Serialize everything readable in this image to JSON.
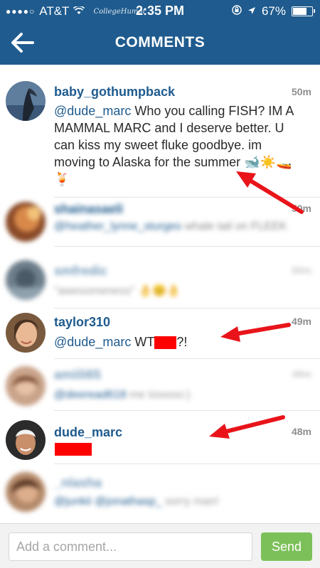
{
  "status_bar": {
    "carrier": "AT&T",
    "signal_dots": "●●●●○",
    "watermark": "CollegeHumor",
    "time": "2:35 PM",
    "battery": "67%"
  },
  "nav": {
    "title": "COMMENTS"
  },
  "comments": [
    {
      "username": "baby_gothumpback",
      "time": "50m",
      "mention": "@dude_marc",
      "text": " Who you calling FISH? IM A MAMMAL MARC and I deserve better. U can kiss my sweet fluke goodbye. im moving to Alaska for the summer",
      "emoji": "🐋☀️🚤🍹"
    },
    {
      "username": "shainasaeli",
      "time": "50m",
      "mention": "@heather_lynne_sturges",
      "text": " whale tail on FLEEK"
    },
    {
      "username": "smfredic",
      "time": "50m",
      "text": "\"awesomeness\" 👌😊👌"
    },
    {
      "username": "taylor310",
      "time": "49m",
      "mention": "@dude_marc",
      "text_before": " WT",
      "text_after": "?!"
    },
    {
      "username": "amiili65",
      "time": "49m",
      "mention": "@deeread618",
      "text": " me tooooo:)"
    },
    {
      "username": "dude_marc",
      "time": "48m"
    },
    {
      "username": "_nlasha",
      "time": "",
      "mention": "@junkii @jonathasp_",
      "text": " sorry man!"
    }
  ],
  "composer": {
    "placeholder": "Add a comment...",
    "send_label": "Send"
  },
  "colors": {
    "header": "#1f5b8e",
    "username": "#1f5b8e",
    "send_button": "#7cc05a",
    "annotation_arrow": "#e8141a",
    "redaction": "#ff0000"
  }
}
